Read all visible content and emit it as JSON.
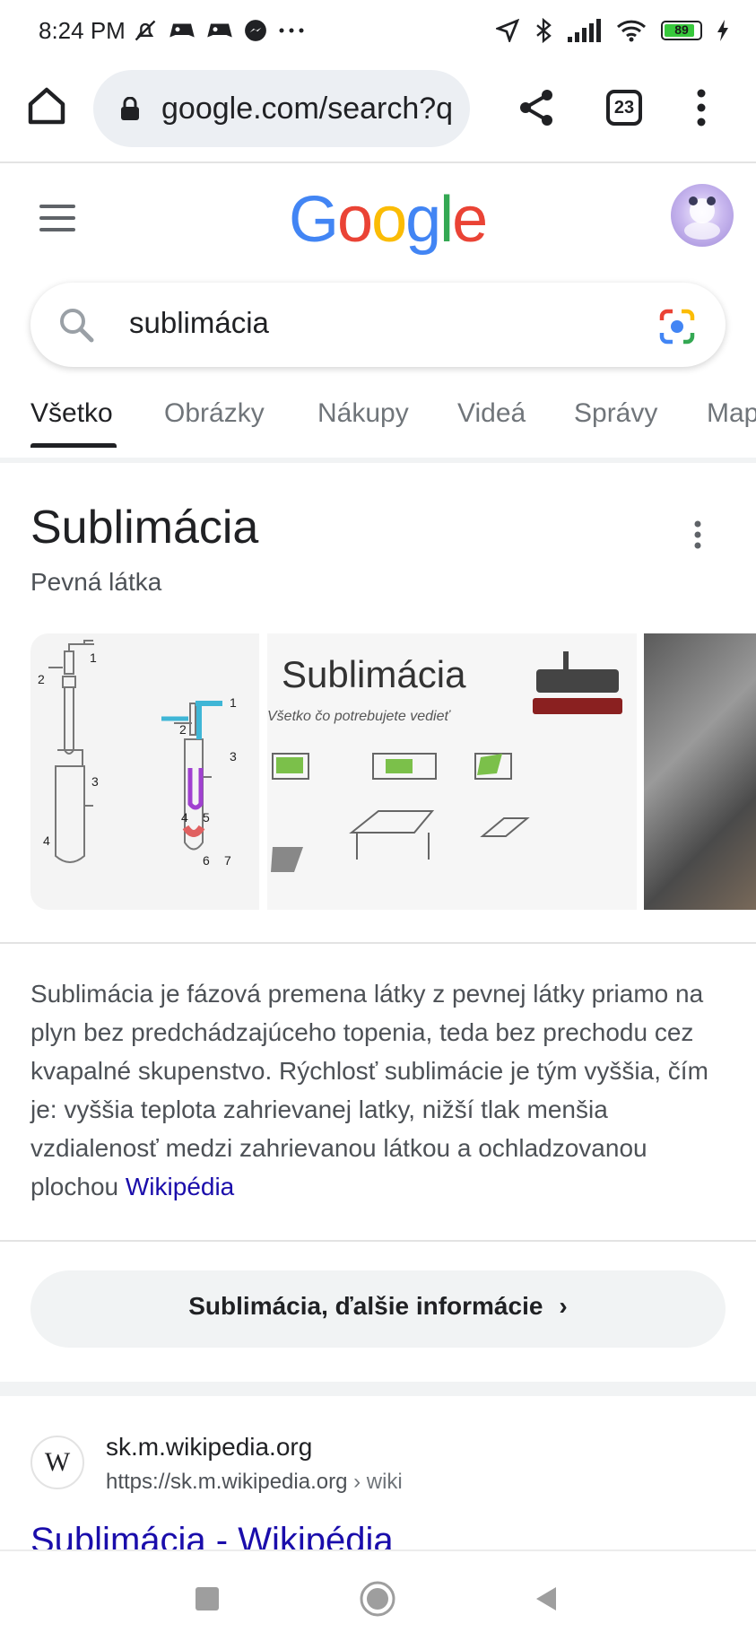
{
  "status_bar": {
    "time": "8:24 PM",
    "battery": "89"
  },
  "browser": {
    "url": "google.com/search?q",
    "tab_count": "23"
  },
  "google": {
    "logo": [
      "G",
      "o",
      "o",
      "g",
      "l",
      "e"
    ],
    "logo_colors": [
      "#4285f4",
      "#ea4335",
      "#fbbc05",
      "#4285f4",
      "#34a853",
      "#ea4335"
    ],
    "search_query": "sublimácia"
  },
  "tabs": [
    "Všetko",
    "Obrázky",
    "Nákupy",
    "Videá",
    "Správy",
    "Mapy"
  ],
  "knowledge_panel": {
    "title": "Sublimácia",
    "subtitle": "Pevná látka",
    "image2_title": "Sublimácia",
    "image2_subtitle": "Všetko čo potrebujete vedieť",
    "description": "Sublimácia je fázová premena látky z pevnej látky priamo na plyn bez predchádzajúceho topenia, teda bez prechodu cez kvapalné skupenstvo. Rýchlosť sublimácie je tým vyššia, čím je: vyššia teplota zahrievanej latky, nižší tlak menšia vzdialenosť medzi zahrievanou látkou a ochladzovanou plochou",
    "source": "Wikipédia",
    "more_label": "Sublimácia, ďalšie informácie"
  },
  "result": {
    "domain": "sk.m.wikipedia.org",
    "url": "https://sk.m.wikipedia.org",
    "crumb": " › wiki",
    "title": "Sublimácia - Wikipédia"
  },
  "colors": {
    "link": "#1a0dab",
    "text": "#202124",
    "secondary": "#4d5156"
  }
}
